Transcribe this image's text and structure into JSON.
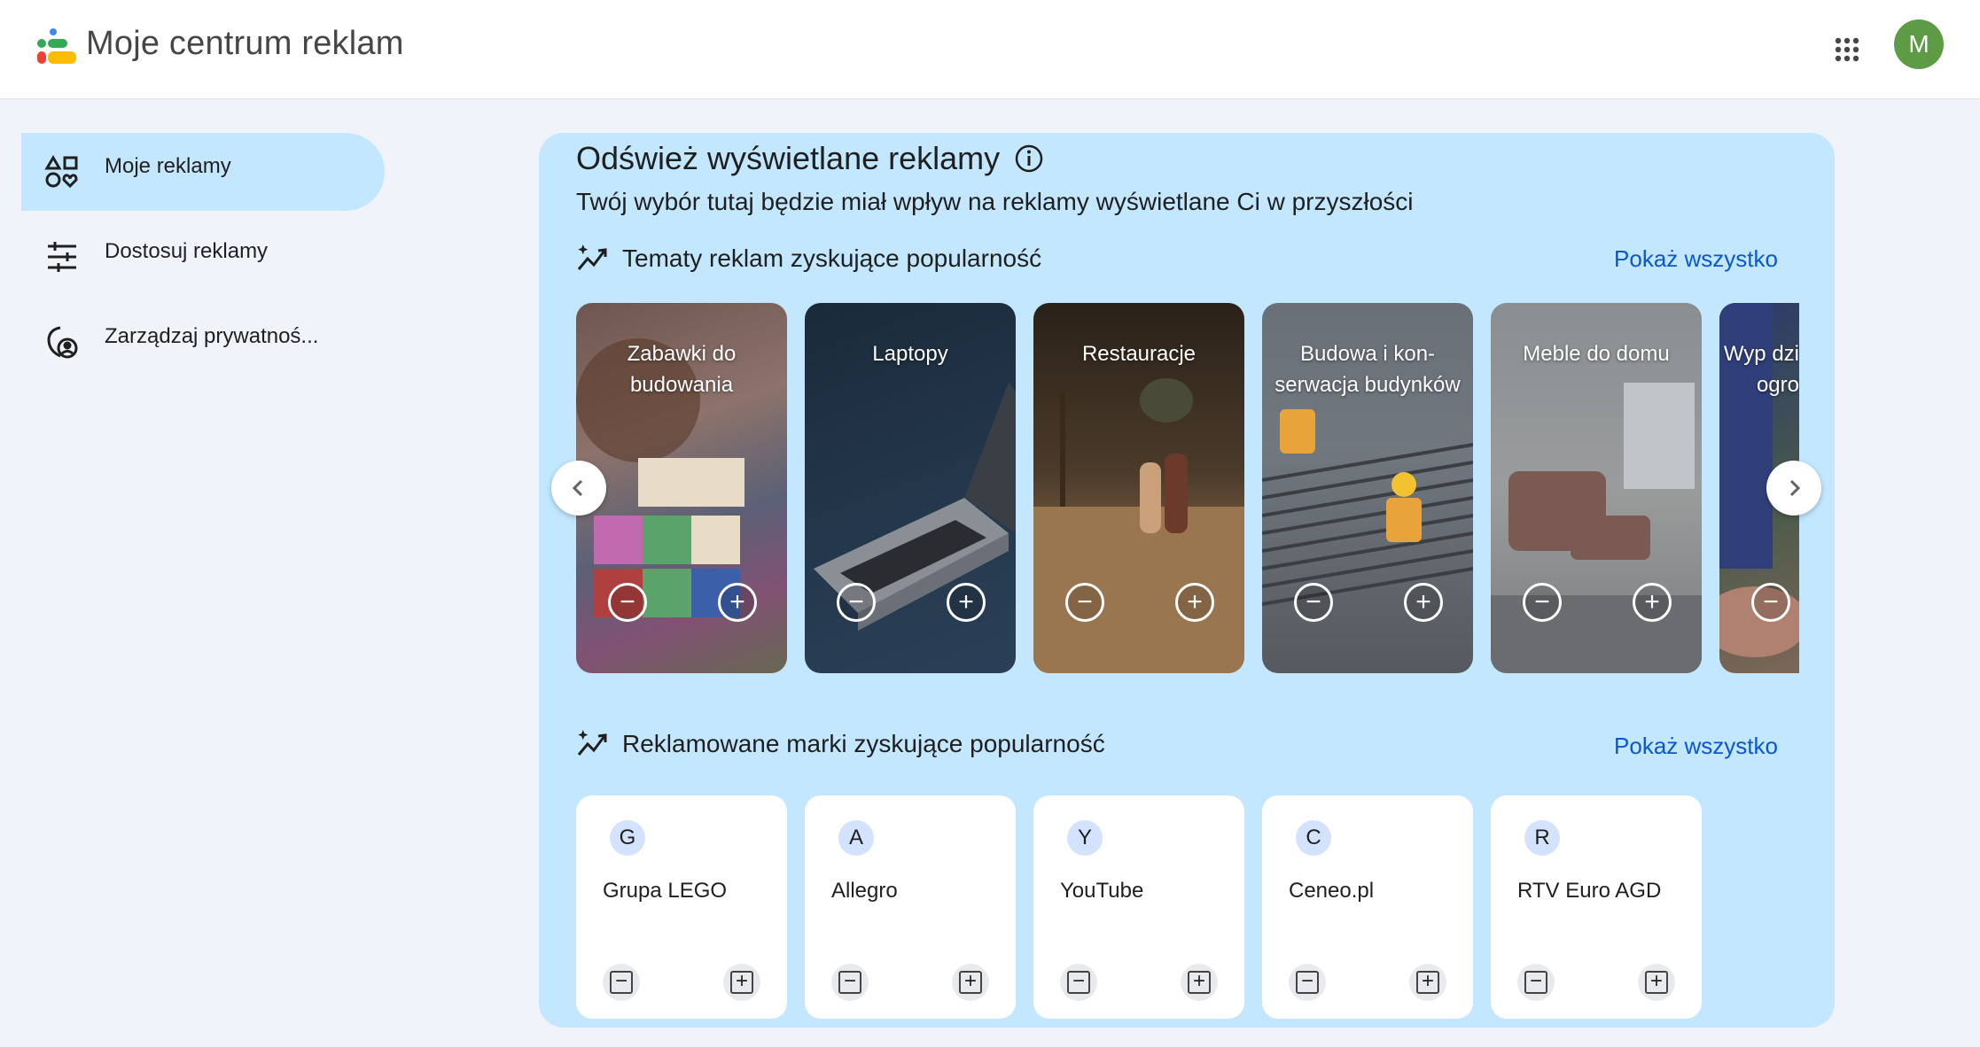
{
  "header": {
    "app_title": "Moje centrum reklam",
    "avatar_letter": "M",
    "avatar_color": "#5d9b45",
    "apps_icon": "apps-grid-icon"
  },
  "sidebar": {
    "items": [
      {
        "label": "Moje reklamy",
        "icon": "my-ads-icon",
        "active": true
      },
      {
        "label": "Dostosuj reklamy",
        "icon": "tune-icon",
        "active": false
      },
      {
        "label": "Zarządzaj prywatnoś...",
        "icon": "privacy-icon",
        "active": false
      }
    ]
  },
  "main": {
    "title": "Odśwież wyświetlane reklamy",
    "subtitle": "Twój wybór tutaj będzie miał wpływ na reklamy wyświetlane Ci w przyszłości",
    "topics_heading": "Tematy reklam zyskujące popularność",
    "topics_show_all": "Pokaż wszystko",
    "topics": [
      {
        "label": "Zabawki do budowania"
      },
      {
        "label": "Laptopy"
      },
      {
        "label": "Restauracje"
      },
      {
        "label": "Budowa i kon-serwacja budynków"
      },
      {
        "label": "Meble do domu"
      },
      {
        "label": "Wyp dzi ogro"
      }
    ],
    "brands_heading": "Reklamowane marki zyskujące popularność",
    "brands_show_all": "Pokaż wszystko",
    "brands": [
      {
        "letter": "G",
        "name": "Grupa LEGO"
      },
      {
        "letter": "A",
        "name": "Allegro"
      },
      {
        "letter": "Y",
        "name": "YouTube"
      },
      {
        "letter": "C",
        "name": "Ceneo.pl"
      },
      {
        "letter": "R",
        "name": "RTV Euro AGD"
      }
    ],
    "minus_symbol": "−",
    "plus_symbol": "+"
  },
  "colors": {
    "accent": "#0b57d0",
    "panel": "#c2e7ff",
    "page_bg": "#f0f4fa"
  }
}
